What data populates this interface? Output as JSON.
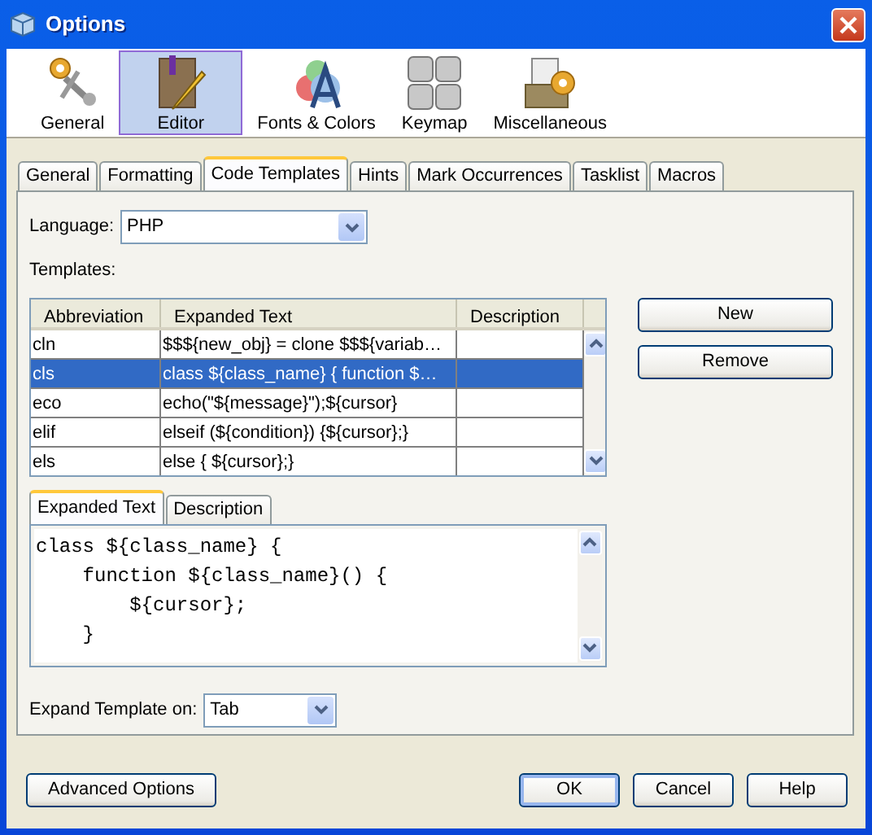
{
  "window": {
    "title": "Options"
  },
  "categories": [
    {
      "label": "General",
      "selected": false
    },
    {
      "label": "Editor",
      "selected": true
    },
    {
      "label": "Fonts & Colors",
      "selected": false
    },
    {
      "label": "Keymap",
      "selected": false
    },
    {
      "label": "Miscellaneous",
      "selected": false
    }
  ],
  "tabs": [
    {
      "label": "General",
      "selected": false
    },
    {
      "label": "Formatting",
      "selected": false
    },
    {
      "label": "Code Templates",
      "selected": true
    },
    {
      "label": "Hints",
      "selected": false
    },
    {
      "label": "Mark Occurrences",
      "selected": false
    },
    {
      "label": "Tasklist",
      "selected": false
    },
    {
      "label": "Macros",
      "selected": false
    }
  ],
  "language": {
    "label": "Language:",
    "value": "PHP"
  },
  "templates_label": "Templates:",
  "table": {
    "columns": [
      "Abbreviation",
      "Expanded Text",
      "Description"
    ],
    "rows": [
      {
        "cells": [
          "cln",
          "$$${new_obj} = clone $$${variab…",
          ""
        ],
        "selected": false
      },
      {
        "cells": [
          "cls",
          "class ${class_name} {    function $…",
          ""
        ],
        "selected": true
      },
      {
        "cells": [
          "eco",
          "echo(\"${message}\");${cursor}",
          ""
        ],
        "selected": false
      },
      {
        "cells": [
          "elif",
          "elseif (${condition}) {${cursor};}",
          ""
        ],
        "selected": false
      },
      {
        "cells": [
          "els",
          "else {    ${cursor};}",
          ""
        ],
        "selected": false
      }
    ]
  },
  "side_buttons": [
    "New",
    "Remove"
  ],
  "editor_tabs": [
    {
      "label": "Expanded Text",
      "selected": true
    },
    {
      "label": "Description",
      "selected": false
    }
  ],
  "code_lines": [
    "class ${class_name} {",
    "    function ${class_name}() {",
    "        ${cursor};",
    "    }"
  ],
  "expand_on": {
    "label": "Expand Template on:",
    "value": "Tab"
  },
  "footer_left": "Advanced Options",
  "footer_buttons": [
    {
      "label": "OK",
      "default": true
    },
    {
      "label": "Cancel",
      "default": false
    },
    {
      "label": "Help",
      "default": false
    }
  ]
}
